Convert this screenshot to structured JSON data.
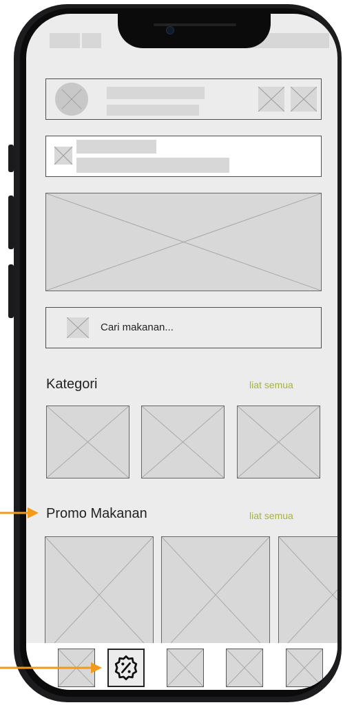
{
  "search": {
    "placeholder": "Cari makanan..."
  },
  "sections": {
    "kategori": {
      "title": "Kategori",
      "link": "liat semua"
    },
    "promo": {
      "title": "Promo Makanan",
      "link": "liat semua"
    }
  },
  "bottom_nav": {
    "items": [
      {
        "icon": "placeholder-icon",
        "active": false
      },
      {
        "icon": "discount-badge-icon",
        "active": true
      },
      {
        "icon": "placeholder-icon",
        "active": false
      },
      {
        "icon": "placeholder-icon",
        "active": false
      },
      {
        "icon": "placeholder-icon",
        "active": false
      }
    ]
  },
  "annotations": {
    "color": "#f29a1a"
  },
  "colors": {
    "accent_link": "#a8b23a",
    "screen_bg": "#ececec"
  }
}
